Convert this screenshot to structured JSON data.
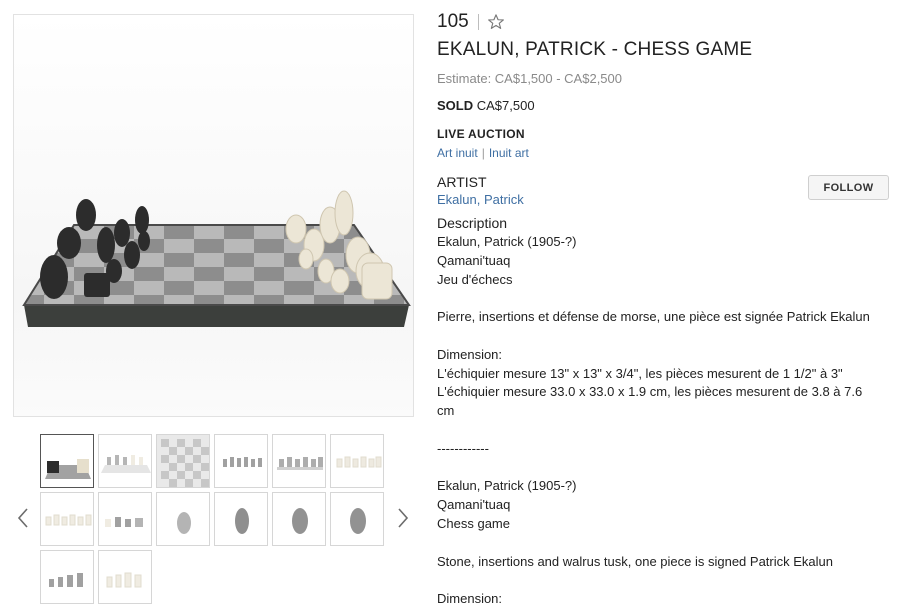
{
  "lot": {
    "number": "105",
    "star_icon": "star-outline-icon"
  },
  "title": "EKALUN, PATRICK - CHESS GAME",
  "estimate": "Estimate: CA$1,500 - CA$2,500",
  "sold": {
    "label": "SOLD",
    "price": "CA$7,500"
  },
  "auction_type": "LIVE AUCTION",
  "categories": [
    "Art inuit",
    "Inuit art"
  ],
  "category_separator": "|",
  "artist": {
    "heading": "ARTIST",
    "name": "Ekalun, Patrick",
    "follow_label": "FOLLOW"
  },
  "description": {
    "heading": "Description",
    "lines": [
      "Ekalun, Patrick (1905-?)",
      "Qamani'tuaq",
      "Jeu d'échecs",
      "",
      "Pierre, insertions et défense de morse, une pièce est signée Patrick Ekalun",
      "",
      "Dimension:",
      "L'échiquier mesure 13\" x 13\" x 3/4\", les pièces mesurent de 1 1/2\" à 3\"",
      "L'échiquier mesure 33.0 x 33.0 x 1.9 cm, les pièces mesurent de 3.8 à 7.6",
      "cm",
      "",
      "------------",
      "",
      "Ekalun, Patrick (1905-?)",
      "Qamani'tuaq",
      "Chess game",
      "",
      "Stone, insertions and walrus tusk, one piece is signed Patrick Ekalun",
      "",
      "Dimension:"
    ]
  },
  "gallery": {
    "thumbnail_count": 14,
    "active_index": 0,
    "prev_icon": "chevron-left-icon",
    "next_icon": "chevron-right-icon"
  },
  "colors": {
    "link": "#3f6fa3",
    "muted": "#8a8a8a",
    "text": "#222222"
  }
}
